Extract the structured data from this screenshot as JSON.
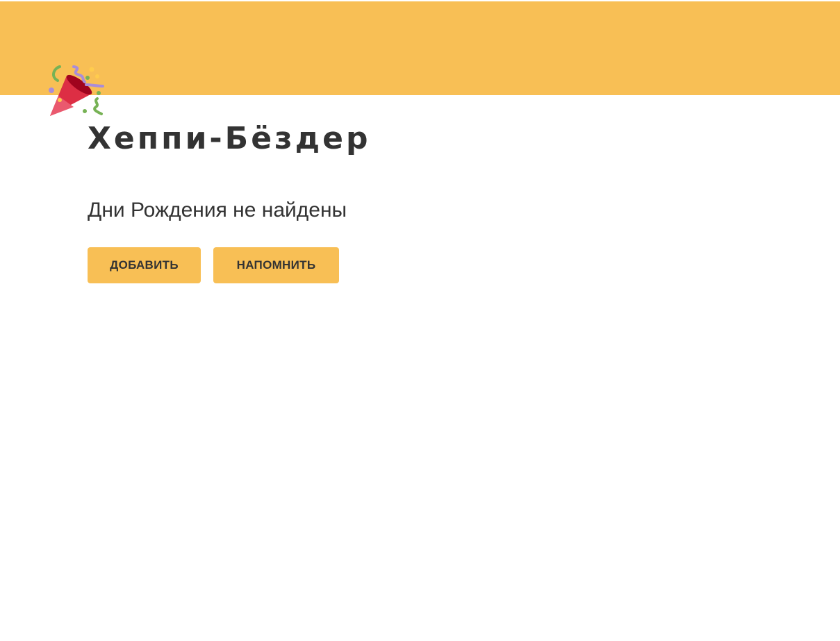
{
  "app": {
    "title": "Хеппи-Бёздер",
    "logo_icon": "party-popper-icon"
  },
  "main": {
    "message": "Дни Рождения не найдены",
    "buttons": {
      "add_label": "ДОБАВИТЬ",
      "remind_label": "НАПОМНИТЬ"
    }
  },
  "colors": {
    "accent": "#F8BF55",
    "text": "#333333",
    "background": "#FFFFFF"
  }
}
